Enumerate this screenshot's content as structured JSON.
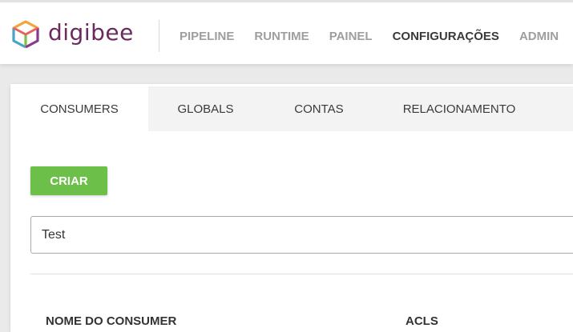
{
  "brand": {
    "logo_text": "digibee"
  },
  "nav": {
    "items": [
      {
        "label": "PIPELINE"
      },
      {
        "label": "RUNTIME"
      },
      {
        "label": "PAINEL"
      },
      {
        "label": "CONFIGURAÇÕES",
        "active": true
      },
      {
        "label": "ADMIN"
      }
    ]
  },
  "tabs": [
    {
      "label": "CONSUMERS",
      "active": true
    },
    {
      "label": "GLOBALS"
    },
    {
      "label": "CONTAS"
    },
    {
      "label": "RELACIONAMENTO"
    }
  ],
  "actions": {
    "create_label": "CRIAR"
  },
  "search": {
    "value": "Test"
  },
  "table": {
    "columns": [
      "NOME DO CONSUMER",
      "ACLS"
    ]
  },
  "colors": {
    "brand": "#6a2b5c",
    "primary_button": "#6cc04a",
    "active_text": "#3a3a3a",
    "muted_text": "#9e9e9e"
  }
}
